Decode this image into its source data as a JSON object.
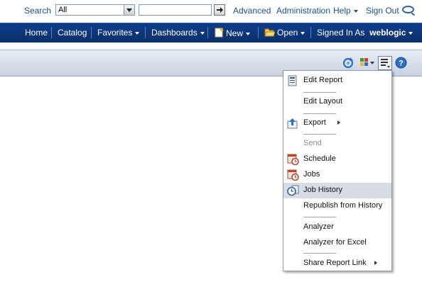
{
  "topbar": {
    "search_label": "Search",
    "scope_value": "All",
    "search_value": "",
    "advanced": "Advanced",
    "administration": "Administration",
    "help": "Help",
    "sign_out": "Sign Out"
  },
  "nav": {
    "home": "Home",
    "catalog": "Catalog",
    "favorites": "Favorites",
    "dashboards": "Dashboards",
    "new": "New",
    "open": "Open",
    "signed_in_as": "Signed In As",
    "user": "weblogic"
  },
  "menu": {
    "items": [
      {
        "label": "Edit Report",
        "icon": "report-edit-icon"
      },
      {
        "label": "Edit Layout"
      },
      {
        "label": "Export",
        "icon": "export-icon",
        "submenu": true
      },
      {
        "label": "Send",
        "disabled": true
      },
      {
        "label": "Schedule",
        "icon": "schedule-icon"
      },
      {
        "label": "Jobs",
        "icon": "jobs-icon"
      },
      {
        "label": "Job History",
        "icon": "job-history-icon",
        "highlighted": true
      },
      {
        "label": "Republish from History"
      },
      {
        "label": "Analyzer"
      },
      {
        "label": "Analyzer for Excel"
      },
      {
        "label": "Share Report Link",
        "submenu": true
      }
    ]
  },
  "colors": {
    "nav_bg": "#0b2f6c",
    "link": "#1f4c8c",
    "menu_highlight": "#d8dde5"
  }
}
